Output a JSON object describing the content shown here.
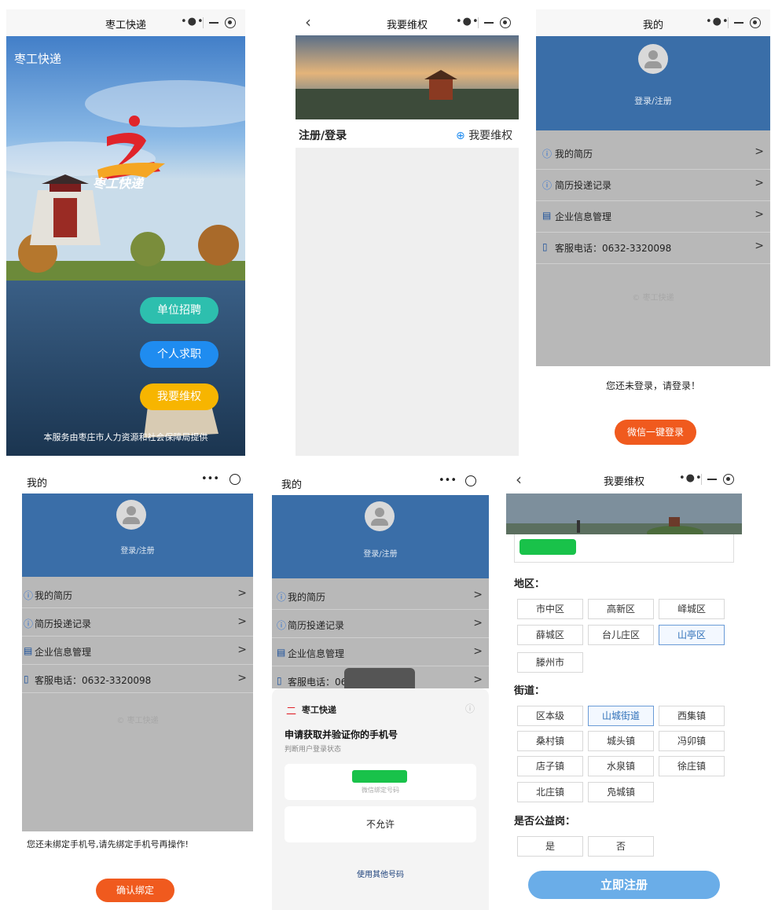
{
  "panel1": {
    "title": "枣工快递",
    "brand": "枣工快递",
    "logo_text": "枣工快递",
    "buttons": [
      "单位招聘",
      "个人求职",
      "我要维权"
    ],
    "button_colors": [
      "#2dbfae",
      "#1f8cf0",
      "#f7b500"
    ],
    "footer": "本服务由枣庄市人力资源和社会保障局提供"
  },
  "panel2": {
    "title": "我要维权",
    "left_label": "注册/登录",
    "right_label": "我要维权",
    "right_icon": "plus-circle-icon"
  },
  "panel3": {
    "title": "我的",
    "login_label": "登录/注册",
    "menu": [
      {
        "icon": "info-icon",
        "label": "我的简历"
      },
      {
        "icon": "info-icon",
        "label": "简历投递记录"
      },
      {
        "icon": "building-icon",
        "label": "企业信息管理"
      },
      {
        "icon": "phone-icon",
        "label": "客服电话：0632-3320098"
      }
    ],
    "watermark": "© 枣工快递",
    "notice": "您还未登录，请登录！",
    "action": "微信一键登录"
  },
  "panel4": {
    "title": "我的",
    "login_label": "登录/注册",
    "menu": [
      {
        "icon": "info-icon",
        "label": "我的简历"
      },
      {
        "icon": "info-icon",
        "label": "简历投递记录"
      },
      {
        "icon": "building-icon",
        "label": "企业信息管理"
      },
      {
        "icon": "phone-icon",
        "label": "客服电话：0632-3320098"
      }
    ],
    "watermark": "© 枣工快递",
    "notice": "您还未绑定手机号,请先绑定手机号再操作!",
    "action": "确认绑定"
  },
  "panel5": {
    "title": "我的",
    "login_label": "登录/注册",
    "menu": [
      {
        "icon": "info-icon",
        "label": "我的简历"
      },
      {
        "icon": "info-icon",
        "label": "简历投递记录"
      },
      {
        "icon": "building-icon",
        "label": "企业信息管理"
      },
      {
        "icon": "phone-icon",
        "label": "客服电话：06"
      }
    ],
    "sheet": {
      "app_name": "枣工快递",
      "heading": "申请获取并验证你的手机号",
      "subheading": "判断用户登录状态",
      "phone_caption": "微信绑定号码",
      "deny": "不允许",
      "other": "使用其他号码"
    }
  },
  "panel6": {
    "title": "我要维权",
    "region_label": "地区：",
    "regions": [
      "市中区",
      "高新区",
      "峄城区",
      "薛城区",
      "台儿庄区",
      "山亭区",
      "滕州市"
    ],
    "region_selected": 5,
    "street_label": "街道：",
    "streets": [
      "区本级",
      "山城街道",
      "西集镇",
      "桑村镇",
      "城头镇",
      "冯卯镇",
      "店子镇",
      "水泉镇",
      "徐庄镇",
      "北庄镇",
      "凫城镇"
    ],
    "street_selected": 1,
    "welfare_label": "是否公益岗：",
    "welfare": [
      "是",
      "否"
    ],
    "submit": "立即注册",
    "accent": "#6aade8"
  }
}
